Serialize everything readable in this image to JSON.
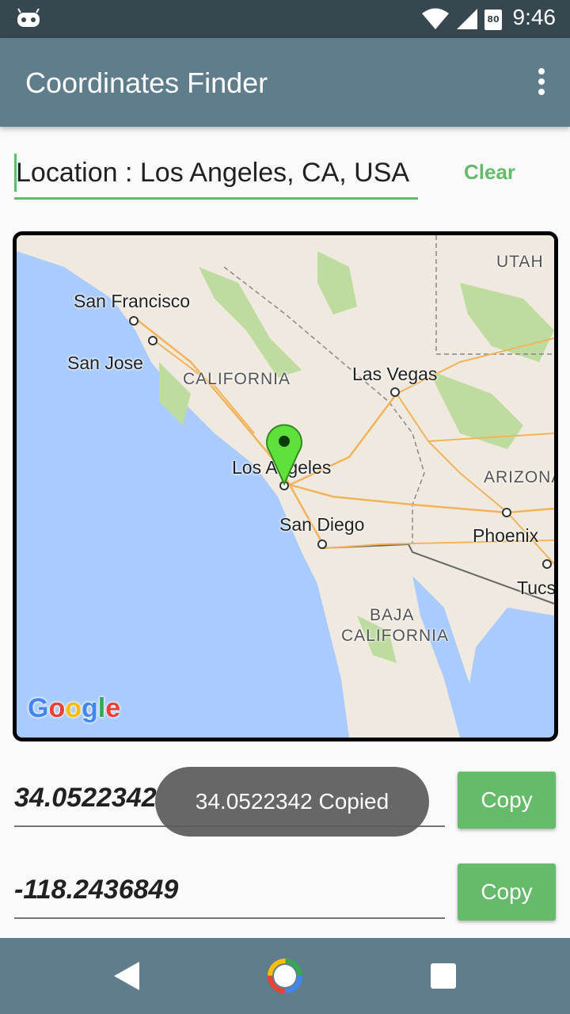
{
  "status_bar": {
    "time": "9:46",
    "battery": "80",
    "icons": [
      "android-robot-icon",
      "wifi-icon",
      "signal-icon",
      "battery-icon"
    ]
  },
  "app_bar": {
    "title": "Coordinates Finder",
    "menu_icon": "overflow-menu-icon"
  },
  "location": {
    "value": "Location : Los Angeles, CA, USA",
    "clear_label": "Clear"
  },
  "map": {
    "labels": {
      "san_francisco": "San Francisco",
      "san_jose": "San Jose",
      "california": "CALIFORNIA",
      "las_vegas": "Las Vegas",
      "utah": "UTAH",
      "los_angeles": "Los Angeles",
      "arizona": "ARIZONA",
      "san_diego": "San Diego",
      "phoenix": "Phoenix",
      "tucson": "Tucs",
      "baja": "BAJA",
      "baja_california": "CALIFORNIA"
    },
    "logo": "Google",
    "marker_icon": "map-pin-icon"
  },
  "latitude": {
    "value": "34.0522342",
    "copy_label": "Copy"
  },
  "longitude": {
    "value": "-118.2436849",
    "copy_label": "Copy"
  },
  "toast": "34.0522342 Copied",
  "colors": {
    "accent": "#66bb6a",
    "app_bar": "#607d8b",
    "status_bar": "#37474f"
  }
}
